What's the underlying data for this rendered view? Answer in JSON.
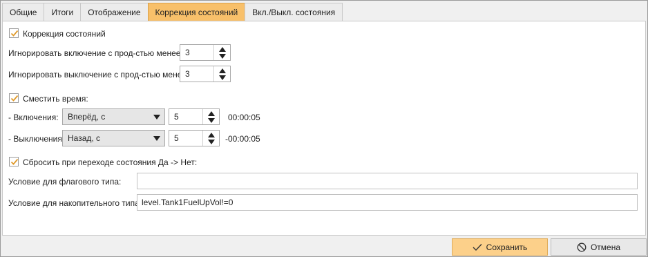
{
  "tabs": [
    {
      "label": "Общие"
    },
    {
      "label": "Итоги"
    },
    {
      "label": "Отображение"
    },
    {
      "label": "Коррекция состояний"
    },
    {
      "label": "Вкл./Выкл. состояния"
    }
  ],
  "correction": {
    "checkbox_label": "Коррекция состояний",
    "ignore_on_label": "Игнорировать включение с прод-стью менее, с:",
    "ignore_on_value": "3",
    "ignore_off_label": "Игнорировать выключение с прод-стью менее, с:",
    "ignore_off_value": "3"
  },
  "shift": {
    "checkbox_label": "Сместить время:",
    "on_label": "- Включения:",
    "on_direction": "Вперёд, с",
    "on_value": "5",
    "on_time": "00:00:05",
    "off_label": "- Выключения:",
    "off_direction": "Назад, с",
    "off_value": "5",
    "off_time": "-00:00:05"
  },
  "reset": {
    "checkbox_label": "Сбросить при переходе состояния Да -> Нет:",
    "flag_label": "Условие для флагового типа:",
    "flag_value": "",
    "accum_label": "Условие для накопительного типа:",
    "accum_value": "level.Tank1FuelUpVol!=0"
  },
  "buttons": {
    "save_label": "Сохранить",
    "cancel_label": "Отмена"
  },
  "colors": {
    "active_tab": "#f8c06a",
    "save_button": "#fcd08a",
    "check": "#e09a2a"
  }
}
